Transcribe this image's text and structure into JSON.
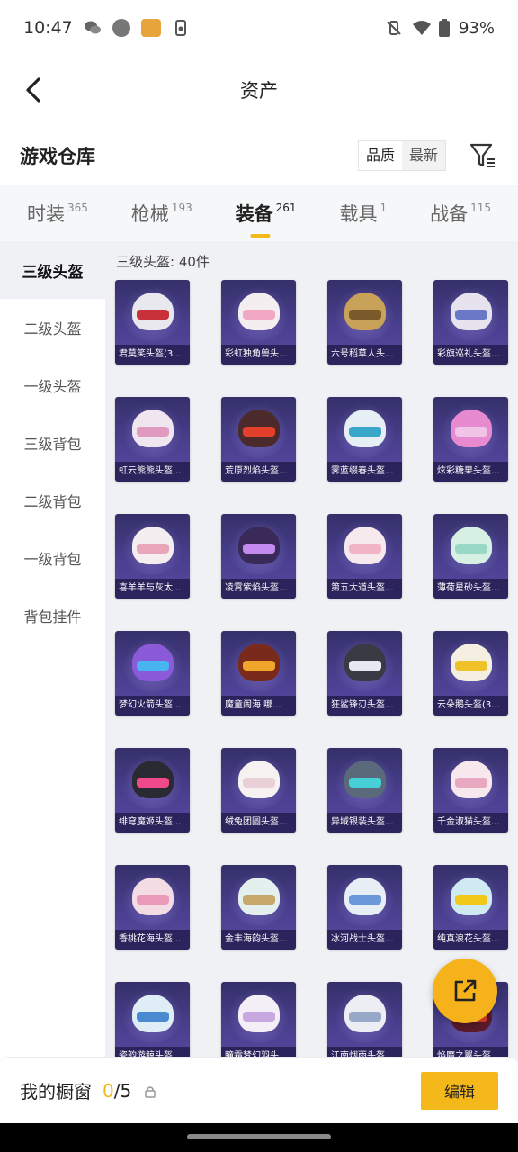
{
  "status_bar": {
    "time": "10:47",
    "battery": "93%"
  },
  "header": {
    "title": "资产"
  },
  "warehouse": {
    "title": "游戏仓库",
    "sort_options": [
      "品质",
      "最新"
    ]
  },
  "tabs": [
    {
      "label": "时装",
      "count": "365"
    },
    {
      "label": "枪械",
      "count": "193"
    },
    {
      "label": "装备",
      "count": "261",
      "active": true
    },
    {
      "label": "载具",
      "count": "1"
    },
    {
      "label": "战备",
      "count": "115"
    }
  ],
  "sidebar": [
    {
      "label": "三级头盔",
      "active": true
    },
    {
      "label": "二级头盔"
    },
    {
      "label": "一级头盔"
    },
    {
      "label": "三级背包"
    },
    {
      "label": "二级背包"
    },
    {
      "label": "一级背包"
    },
    {
      "label": "背包挂件"
    }
  ],
  "section_label": "三级头盔: 40件",
  "items": [
    {
      "name": "君莫笑头盔(3...",
      "color": "#e8e8ee",
      "accent": "#c8313a"
    },
    {
      "name": "彩虹独角兽头...",
      "color": "#f4eef0",
      "accent": "#f0a8c4"
    },
    {
      "name": "六号稻草人头...",
      "color": "#c9a25a",
      "accent": "#7a5a2a"
    },
    {
      "name": "彩旗巡礼头盔...",
      "color": "#e6e2ee",
      "accent": "#6a78c8"
    },
    {
      "name": "虹云熊熊头盔...",
      "color": "#f0e6f0",
      "accent": "#e09ac0"
    },
    {
      "name": "荒原烈焰头盔...",
      "color": "#4a2a2a",
      "accent": "#e2402a"
    },
    {
      "name": "霁蓝缀春头盔...",
      "color": "#e6f0f4",
      "accent": "#3aa6c8"
    },
    {
      "name": "炫彩糖果头盔...",
      "color": "#e88ad0",
      "accent": "#f0c4e6"
    },
    {
      "name": "喜羊羊与灰太...",
      "color": "#f4eef0",
      "accent": "#e8a6b8"
    },
    {
      "name": "凌霄紫焰头盔...",
      "color": "#3a2a5a",
      "accent": "#c28af0"
    },
    {
      "name": "第五大道头盔...",
      "color": "#f6eaee",
      "accent": "#f0b4c4"
    },
    {
      "name": "薄荷星砂头盔...",
      "color": "#d6f0e4",
      "accent": "#98d8c4"
    },
    {
      "name": "梦幻火箭头盔...",
      "color": "#8a5ad8",
      "accent": "#48b4f0"
    },
    {
      "name": "魔童闹海 哪...",
      "color": "#7a2a1a",
      "accent": "#f0a62a"
    },
    {
      "name": "狂鲨锋刃头盔...",
      "color": "#3a3a44",
      "accent": "#e8e8f0"
    },
    {
      "name": "云朵鹅头盔(3...",
      "color": "#f4efe0",
      "accent": "#f0c22a"
    },
    {
      "name": "绯穹魔姬头盔...",
      "color": "#2a2a32",
      "accent": "#f04a8a"
    },
    {
      "name": "绒兔团圆头盔...",
      "color": "#f6f2f2",
      "accent": "#e8d0d6"
    },
    {
      "name": "异域银装头盔...",
      "color": "#5a6a7a",
      "accent": "#48d0d8"
    },
    {
      "name": "千金淑猫头盔...",
      "color": "#f6e8ec",
      "accent": "#e8a8c0"
    },
    {
      "name": "香桃花海头盔...",
      "color": "#f4dce4",
      "accent": "#e89ab8"
    },
    {
      "name": "金丰海韵头盔...",
      "color": "#e4f0ee",
      "accent": "#c8a86a"
    },
    {
      "name": "冰河战士头盔...",
      "color": "#e8eef6",
      "accent": "#6a98d8"
    },
    {
      "name": "纯真浪花头盔...",
      "color": "#cfeaf2",
      "accent": "#f0c81a"
    },
    {
      "name": "瓷韵游鲸头盔...",
      "color": "#dfeef6",
      "accent": "#4a8ad0"
    },
    {
      "name": "瞳霜梦幻羽头...",
      "color": "#f4eef6",
      "accent": "#c8a8e0"
    },
    {
      "name": "江南烟雨头盔...",
      "color": "#eceef4",
      "accent": "#98a8c8"
    },
    {
      "name": "焰魔之翼头盔...",
      "color": "#5a1a2a",
      "accent": "#e2402a"
    }
  ],
  "bottom_bar": {
    "label": "我的橱窗",
    "current": "0",
    "max": "/5",
    "edit_label": "编辑"
  }
}
